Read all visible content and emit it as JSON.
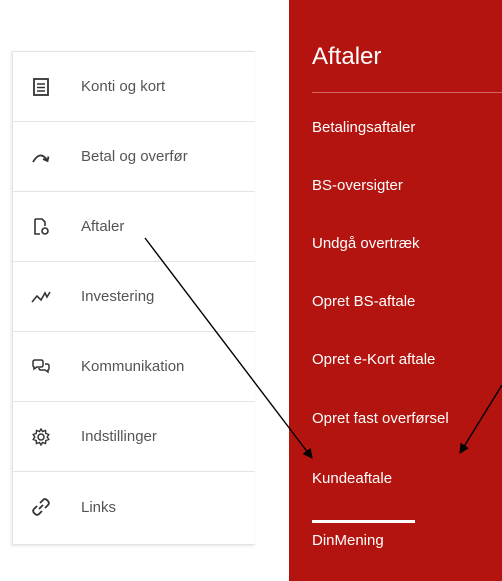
{
  "sidebar": {
    "items": [
      {
        "label": "Konti og kort",
        "icon": "account-list-icon"
      },
      {
        "label": "Betal og overfør",
        "icon": "curved-arrow-icon"
      },
      {
        "label": "Aftaler",
        "icon": "document-gear-icon"
      },
      {
        "label": "Investering",
        "icon": "trend-line-icon"
      },
      {
        "label": "Kommunikation",
        "icon": "chat-bubbles-icon"
      },
      {
        "label": "Indstillinger",
        "icon": "gear-icon"
      },
      {
        "label": "Links",
        "icon": "link-icon"
      }
    ]
  },
  "submenu": {
    "title": "Aftaler",
    "items": [
      {
        "label": "Betalingsaftaler"
      },
      {
        "label": "BS-oversigter"
      },
      {
        "label": "Undgå overtræk"
      },
      {
        "label": "Opret BS-aftale"
      },
      {
        "label": "Opret e-Kort aftale"
      },
      {
        "label": "Opret fast overførsel"
      },
      {
        "label": "Kundeaftale",
        "active": true
      },
      {
        "label": "DinMening"
      }
    ]
  },
  "colors": {
    "panel_red": "#b4140f",
    "sidebar_text": "#555555",
    "arrow": "#000000"
  }
}
